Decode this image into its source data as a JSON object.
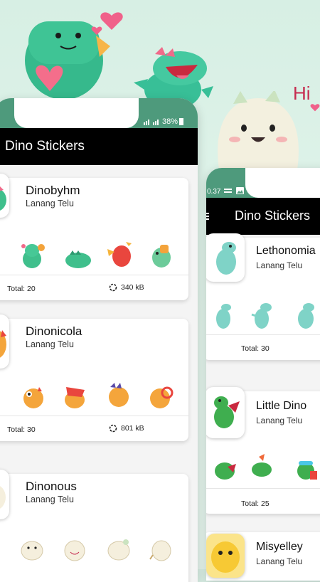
{
  "background": {
    "hi_text": "Hi",
    "accent_colors": [
      "#35b58a",
      "#f06a8a",
      "#8bd6c3"
    ]
  },
  "phone_left": {
    "status": {
      "battery": "38%"
    },
    "app_title": "Dino Stickers",
    "packs": [
      {
        "name": "Dinobyhm",
        "author": "Lanang Telu",
        "total": "Total: 20",
        "size": "340 kB"
      },
      {
        "name": "Dinonicola",
        "author": "Lanang Telu",
        "total": "Total: 30",
        "size": "801 kB"
      },
      {
        "name": "Dinonous",
        "author": "Lanang Telu"
      }
    ]
  },
  "phone_right": {
    "status": {
      "time": "0.37"
    },
    "app_title": "Dino Stickers",
    "packs": [
      {
        "name": "Lethonomia",
        "author": "Lanang Telu",
        "total": "Total: 30"
      },
      {
        "name": "Little Dino",
        "author": "Lanang Telu",
        "total": "Total: 25"
      },
      {
        "name": "Misyelley",
        "author": "Lanang Telu"
      }
    ]
  }
}
